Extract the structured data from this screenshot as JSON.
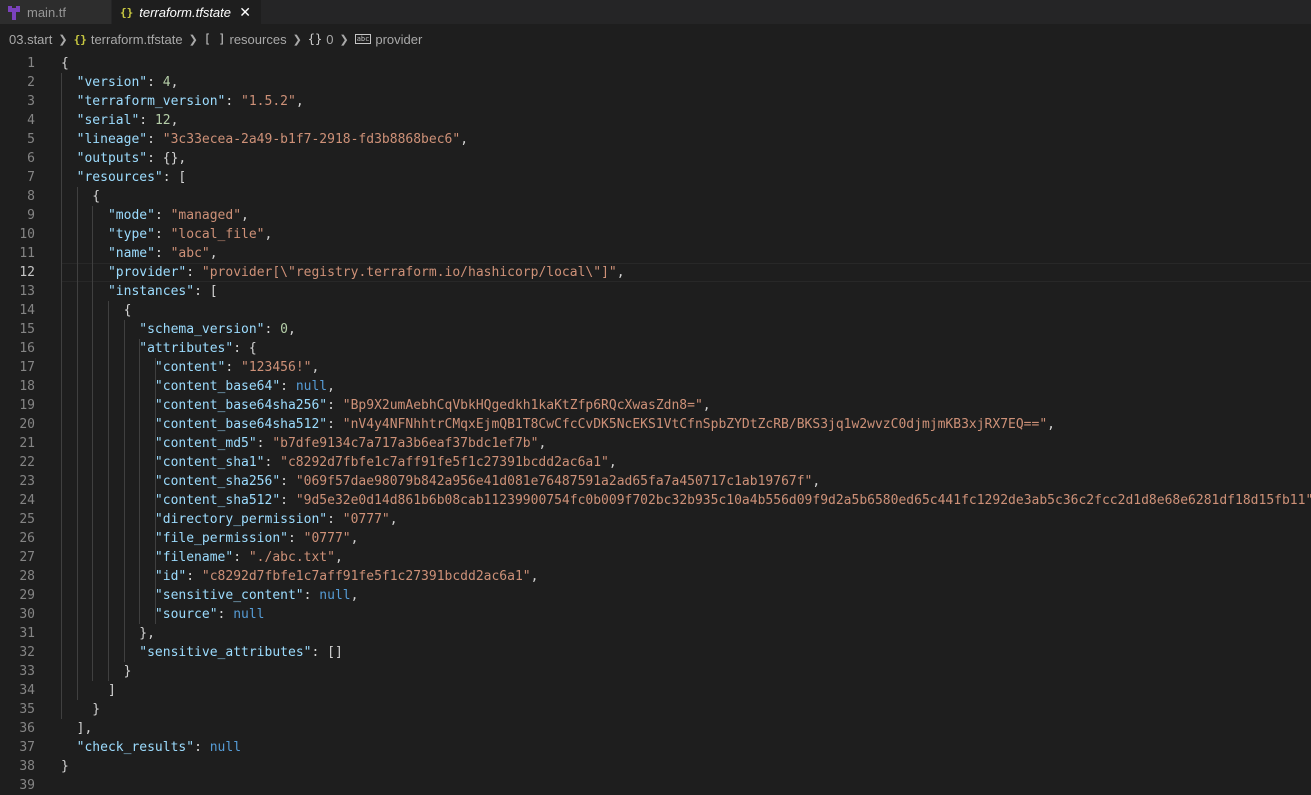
{
  "tabs": [
    {
      "label": "main.tf",
      "active": false,
      "icon": "terraform-icon"
    },
    {
      "label": "terraform.tfstate",
      "active": true,
      "icon": "json-braces-icon"
    }
  ],
  "breadcrumbs": [
    "03.start",
    "terraform.tfstate",
    "resources",
    "0",
    "provider"
  ],
  "current_line": 12,
  "colors": {
    "key": "#9cdcfe",
    "string": "#ce9178",
    "number": "#b5cea8",
    "keyword": "#569cd6"
  },
  "lines": [
    [
      [
        "{",
        "p"
      ]
    ],
    [
      [
        "  ",
        "p"
      ],
      [
        "\"version\"",
        "k"
      ],
      [
        ": ",
        "p"
      ],
      [
        "4",
        "n"
      ],
      [
        ",",
        "p"
      ]
    ],
    [
      [
        "  ",
        "p"
      ],
      [
        "\"terraform_version\"",
        "k"
      ],
      [
        ": ",
        "p"
      ],
      [
        "\"1.5.2\"",
        "s"
      ],
      [
        ",",
        "p"
      ]
    ],
    [
      [
        "  ",
        "p"
      ],
      [
        "\"serial\"",
        "k"
      ],
      [
        ": ",
        "p"
      ],
      [
        "12",
        "n"
      ],
      [
        ",",
        "p"
      ]
    ],
    [
      [
        "  ",
        "p"
      ],
      [
        "\"lineage\"",
        "k"
      ],
      [
        ": ",
        "p"
      ],
      [
        "\"3c33ecea-2a49-b1f7-2918-fd3b8868bec6\"",
        "s"
      ],
      [
        ",",
        "p"
      ]
    ],
    [
      [
        "  ",
        "p"
      ],
      [
        "\"outputs\"",
        "k"
      ],
      [
        ": {},",
        "p"
      ]
    ],
    [
      [
        "  ",
        "p"
      ],
      [
        "\"resources\"",
        "k"
      ],
      [
        ": [",
        "p"
      ]
    ],
    [
      [
        "    {",
        "p"
      ]
    ],
    [
      [
        "      ",
        "p"
      ],
      [
        "\"mode\"",
        "k"
      ],
      [
        ": ",
        "p"
      ],
      [
        "\"managed\"",
        "s"
      ],
      [
        ",",
        "p"
      ]
    ],
    [
      [
        "      ",
        "p"
      ],
      [
        "\"type\"",
        "k"
      ],
      [
        ": ",
        "p"
      ],
      [
        "\"local_file\"",
        "s"
      ],
      [
        ",",
        "p"
      ]
    ],
    [
      [
        "      ",
        "p"
      ],
      [
        "\"name\"",
        "k"
      ],
      [
        ": ",
        "p"
      ],
      [
        "\"abc\"",
        "s"
      ],
      [
        ",",
        "p"
      ]
    ],
    [
      [
        "      ",
        "p"
      ],
      [
        "\"provider\"",
        "k"
      ],
      [
        ": ",
        "p"
      ],
      [
        "\"provider[\\\"registry.terraform.io/hashicorp/local\\\"]\"",
        "s"
      ],
      [
        ",",
        "p"
      ]
    ],
    [
      [
        "      ",
        "p"
      ],
      [
        "\"instances\"",
        "k"
      ],
      [
        ": [",
        "p"
      ]
    ],
    [
      [
        "        {",
        "p"
      ]
    ],
    [
      [
        "          ",
        "p"
      ],
      [
        "\"schema_version\"",
        "k"
      ],
      [
        ": ",
        "p"
      ],
      [
        "0",
        "n"
      ],
      [
        ",",
        "p"
      ]
    ],
    [
      [
        "          ",
        "p"
      ],
      [
        "\"attributes\"",
        "k"
      ],
      [
        ": {",
        "p"
      ]
    ],
    [
      [
        "            ",
        "p"
      ],
      [
        "\"content\"",
        "k"
      ],
      [
        ": ",
        "p"
      ],
      [
        "\"123456!\"",
        "s"
      ],
      [
        ",",
        "p"
      ]
    ],
    [
      [
        "            ",
        "p"
      ],
      [
        "\"content_base64\"",
        "k"
      ],
      [
        ": ",
        "p"
      ],
      [
        "null",
        "kw"
      ],
      [
        ",",
        "p"
      ]
    ],
    [
      [
        "            ",
        "p"
      ],
      [
        "\"content_base64sha256\"",
        "k"
      ],
      [
        ": ",
        "p"
      ],
      [
        "\"Bp9X2umAebhCqVbkHQgedkh1kaKtZfp6RQcXwasZdn8=\"",
        "s"
      ],
      [
        ",",
        "p"
      ]
    ],
    [
      [
        "            ",
        "p"
      ],
      [
        "\"content_base64sha512\"",
        "k"
      ],
      [
        ": ",
        "p"
      ],
      [
        "\"nV4y4NFNhhtrCMqxEjmQB1T8CwCfcCvDK5NcEKS1VtCfnSpbZYDtZcRB/BKS3jq1w2wvzC0djmjmKB3xjRX7EQ==\"",
        "s"
      ],
      [
        ",",
        "p"
      ]
    ],
    [
      [
        "            ",
        "p"
      ],
      [
        "\"content_md5\"",
        "k"
      ],
      [
        ": ",
        "p"
      ],
      [
        "\"b7dfe9134c7a717a3b6eaf37bdc1ef7b\"",
        "s"
      ],
      [
        ",",
        "p"
      ]
    ],
    [
      [
        "            ",
        "p"
      ],
      [
        "\"content_sha1\"",
        "k"
      ],
      [
        ": ",
        "p"
      ],
      [
        "\"c8292d7fbfe1c7aff91fe5f1c27391bcdd2ac6a1\"",
        "s"
      ],
      [
        ",",
        "p"
      ]
    ],
    [
      [
        "            ",
        "p"
      ],
      [
        "\"content_sha256\"",
        "k"
      ],
      [
        ": ",
        "p"
      ],
      [
        "\"069f57dae98079b842a956e41d081e76487591a2ad65fa7a450717c1ab19767f\"",
        "s"
      ],
      [
        ",",
        "p"
      ]
    ],
    [
      [
        "            ",
        "p"
      ],
      [
        "\"content_sha512\"",
        "k"
      ],
      [
        ": ",
        "p"
      ],
      [
        "\"9d5e32e0d14d861b6b08cab11239900754fc0b009f702bc32b935c10a4b556d09f9d2a5b6580ed65c441fc1292de3ab5c36c2fcc2d1d8e68e6281df18d15fb11\"",
        "s"
      ],
      [
        ",",
        "p"
      ]
    ],
    [
      [
        "            ",
        "p"
      ],
      [
        "\"directory_permission\"",
        "k"
      ],
      [
        ": ",
        "p"
      ],
      [
        "\"0777\"",
        "s"
      ],
      [
        ",",
        "p"
      ]
    ],
    [
      [
        "            ",
        "p"
      ],
      [
        "\"file_permission\"",
        "k"
      ],
      [
        ": ",
        "p"
      ],
      [
        "\"0777\"",
        "s"
      ],
      [
        ",",
        "p"
      ]
    ],
    [
      [
        "            ",
        "p"
      ],
      [
        "\"filename\"",
        "k"
      ],
      [
        ": ",
        "p"
      ],
      [
        "\"./abc.txt\"",
        "s"
      ],
      [
        ",",
        "p"
      ]
    ],
    [
      [
        "            ",
        "p"
      ],
      [
        "\"id\"",
        "k"
      ],
      [
        ": ",
        "p"
      ],
      [
        "\"c8292d7fbfe1c7aff91fe5f1c27391bcdd2ac6a1\"",
        "s"
      ],
      [
        ",",
        "p"
      ]
    ],
    [
      [
        "            ",
        "p"
      ],
      [
        "\"sensitive_content\"",
        "k"
      ],
      [
        ": ",
        "p"
      ],
      [
        "null",
        "kw"
      ],
      [
        ",",
        "p"
      ]
    ],
    [
      [
        "            ",
        "p"
      ],
      [
        "\"source\"",
        "k"
      ],
      [
        ": ",
        "p"
      ],
      [
        "null",
        "kw"
      ]
    ],
    [
      [
        "          },",
        "p"
      ]
    ],
    [
      [
        "          ",
        "p"
      ],
      [
        "\"sensitive_attributes\"",
        "k"
      ],
      [
        ": []",
        "p"
      ]
    ],
    [
      [
        "        }",
        "p"
      ]
    ],
    [
      [
        "      ]",
        "p"
      ]
    ],
    [
      [
        "    }",
        "p"
      ]
    ],
    [
      [
        "  ],",
        "p"
      ]
    ],
    [
      [
        "  ",
        "p"
      ],
      [
        "\"check_results\"",
        "k"
      ],
      [
        ": ",
        "p"
      ],
      [
        "null",
        "kw"
      ]
    ],
    [
      [
        "}",
        "p"
      ]
    ],
    [
      [
        "",
        "p"
      ]
    ]
  ]
}
